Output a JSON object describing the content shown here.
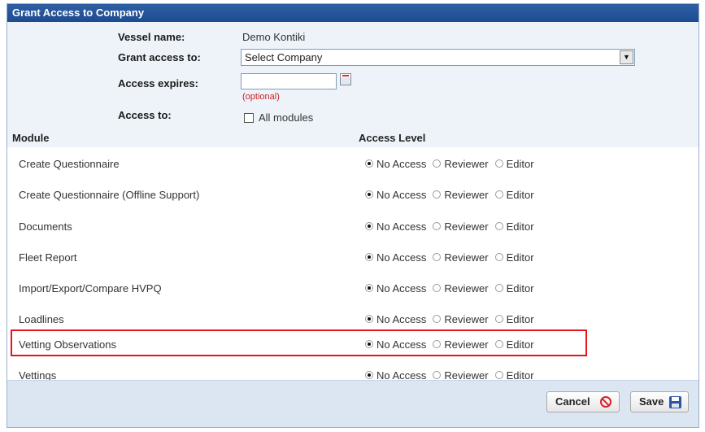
{
  "dialog": {
    "title": "Grant Access to Company"
  },
  "form": {
    "vessel_label": "Vessel name:",
    "vessel_value": "Demo Kontiki",
    "grant_label": "Grant access to:",
    "grant_selected": "Select Company",
    "expires_label": "Access expires:",
    "expires_value": "",
    "optional_hint": "(optional)",
    "access_to_label": "Access to:",
    "all_modules_label": "All modules",
    "all_modules_checked": false
  },
  "table": {
    "col_module": "Module",
    "col_access": "Access Level",
    "options": [
      "No Access",
      "Reviewer",
      "Editor"
    ],
    "rows": [
      {
        "module": "Create Questionnaire",
        "selected": "No Access"
      },
      {
        "module": "Create Questionnaire (Offline Support)",
        "selected": "No Access"
      },
      {
        "module": "Documents",
        "selected": "No Access"
      },
      {
        "module": "Fleet Report",
        "selected": "No Access"
      },
      {
        "module": "Import/Export/Compare HVPQ",
        "selected": "No Access"
      },
      {
        "module": "Loadlines",
        "selected": "No Access"
      },
      {
        "module": "Vetting Observations",
        "selected": "No Access"
      },
      {
        "module": "Vettings",
        "selected": "No Access"
      }
    ]
  },
  "footer": {
    "cancel_label": "Cancel",
    "save_label": "Save"
  },
  "colors": {
    "title_bar": "#1e4b8f",
    "highlight_box": "#e0161b",
    "optional_text": "#cc2222"
  },
  "icons": [
    "dropdown-arrow-icon",
    "calendar-icon",
    "cancel-icon",
    "save-icon"
  ]
}
